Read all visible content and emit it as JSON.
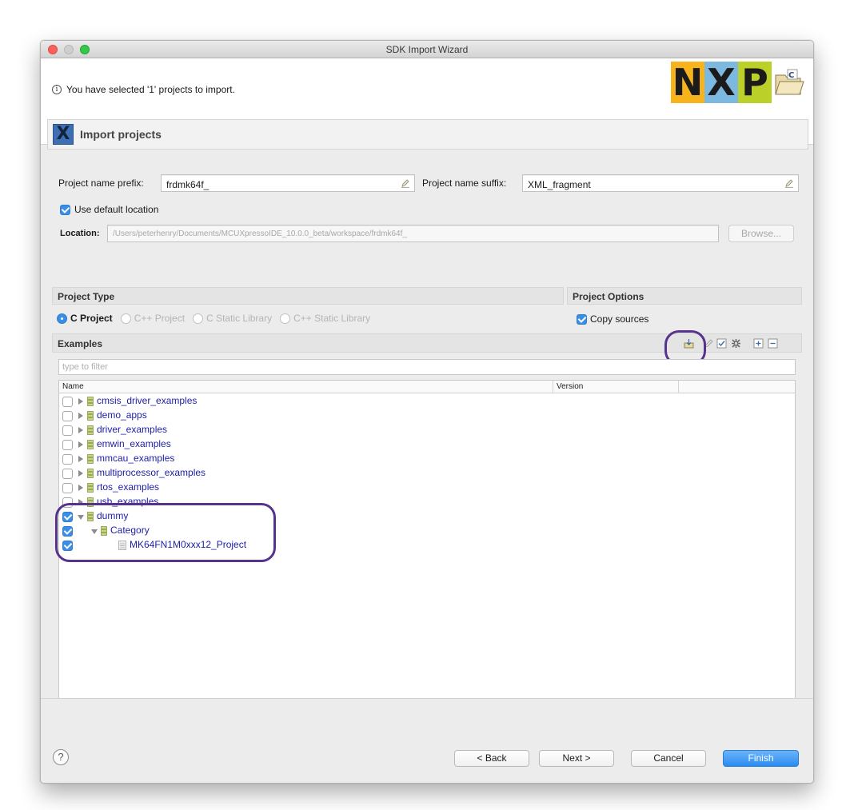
{
  "window": {
    "title": "SDK Import Wizard"
  },
  "banner": {
    "message": "You have selected '1' projects to import.",
    "logo_text": [
      "N",
      "X",
      "P"
    ],
    "colors": {
      "n": "#f6b31b",
      "x": "#7cb8e0",
      "p": "#bcd02a"
    }
  },
  "section": {
    "title": "Import projects",
    "icon": "x-icon"
  },
  "form": {
    "prefix_label": "Project name prefix:",
    "prefix_value": "frdmk64f_",
    "suffix_label": "Project name suffix:",
    "suffix_value": "XML_fragment",
    "use_default_location_label": "Use default location",
    "use_default_location_checked": true,
    "location_label": "Location:",
    "location_value": "/Users/peterhenry/Documents/MCUXpressoIDE_10.0.0_beta/workspace/frdmk64f_",
    "browse_label": "Browse..."
  },
  "project_type": {
    "title": "Project Type",
    "options": [
      "C Project",
      "C++ Project",
      "C Static Library",
      "C++ Static Library"
    ],
    "selected": "C Project"
  },
  "project_options": {
    "title": "Project Options",
    "copy_sources_label": "Copy sources",
    "copy_sources_checked": true
  },
  "examples": {
    "title": "Examples",
    "filter_placeholder": "type to filter",
    "columns": {
      "name": "Name",
      "version": "Version"
    },
    "toolbar_icons": [
      "import-archive-icon",
      "edit-icon",
      "select-all-icon",
      "settings-icon",
      "expand-all-icon",
      "collapse-all-icon"
    ],
    "rows": [
      {
        "label": "cmsis_driver_examples",
        "checked": false,
        "expanded": false
      },
      {
        "label": "demo_apps",
        "checked": false,
        "expanded": false
      },
      {
        "label": "driver_examples",
        "checked": false,
        "expanded": false
      },
      {
        "label": "emwin_examples",
        "checked": false,
        "expanded": false
      },
      {
        "label": "mmcau_examples",
        "checked": false,
        "expanded": false
      },
      {
        "label": "multiprocessor_examples",
        "checked": false,
        "expanded": false
      },
      {
        "label": "rtos_examples",
        "checked": false,
        "expanded": false
      },
      {
        "label": "usb_examples",
        "checked": false,
        "expanded": false
      },
      {
        "label": "dummy",
        "checked": true,
        "expanded": true
      },
      {
        "label": "Category",
        "checked": true,
        "expanded": true
      },
      {
        "label": "MK64FN1M0xxx12_Project",
        "checked": true,
        "expanded": false
      }
    ]
  },
  "footer": {
    "help_label": "?",
    "back_label": "< Back",
    "next_label": "Next >",
    "cancel_label": "Cancel",
    "finish_label": "Finish"
  },
  "colors": {
    "accent": "#3a8ee6",
    "highlight_ring": "#56338c",
    "tree_text": "#1d1dab"
  }
}
